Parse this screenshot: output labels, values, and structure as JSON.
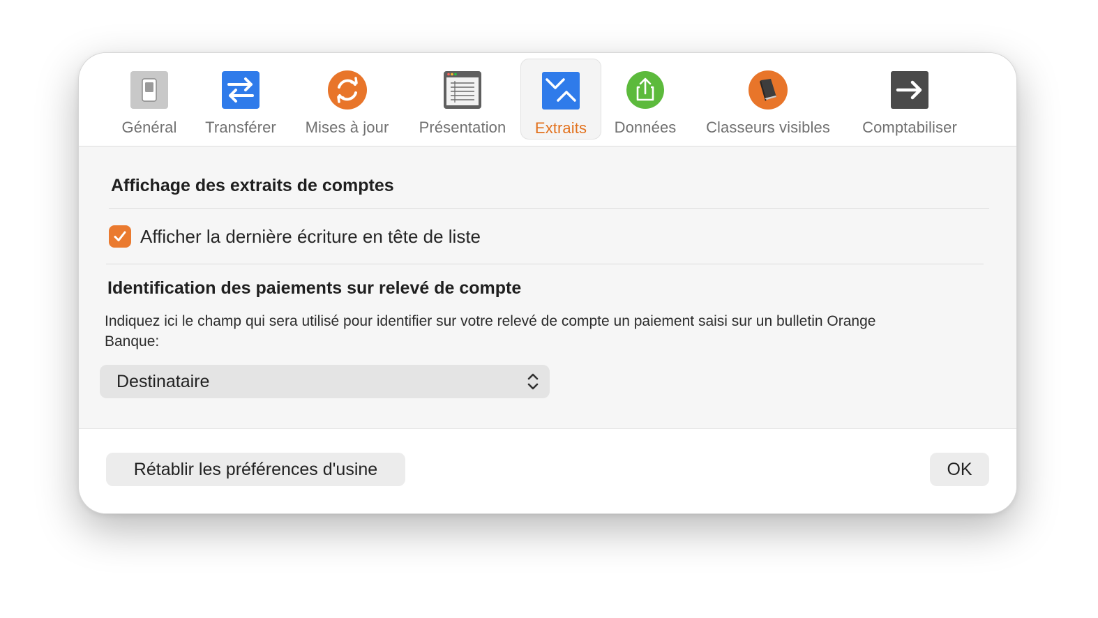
{
  "toolbar": {
    "tabs": [
      {
        "label": "Général",
        "icon": "switch-icon"
      },
      {
        "label": "Transférer",
        "icon": "transfer-arrows-icon"
      },
      {
        "label": "Mises à jour",
        "icon": "sync-icon"
      },
      {
        "label": "Présentation",
        "icon": "window-list-icon"
      },
      {
        "label": "Extraits",
        "icon": "statement-icon",
        "selected": true
      },
      {
        "label": "Données",
        "icon": "share-export-icon"
      },
      {
        "label": "Classeurs visibles",
        "icon": "binder-book-icon"
      },
      {
        "label": "Comptabiliser",
        "icon": "arrow-right-icon"
      }
    ]
  },
  "content": {
    "section1_title": "Affichage des extraits de comptes",
    "checkbox": {
      "label": "Afficher la dernière écriture en tête de liste",
      "checked": true
    },
    "section2_title": "Identification des paiements sur relevé de compte",
    "description": "Indiquez ici le champ qui sera utilisé pour identifier sur votre relevé de compte un paiement saisi sur un bulletin Orange Banque:",
    "popup": {
      "value": "Destinataire"
    }
  },
  "footer": {
    "reset_label": "Rétablir les préférences d'usine",
    "ok_label": "OK"
  },
  "colors": {
    "accent": "#e2711d",
    "checkbox": "#ea7a2f",
    "blue_icon": "#2f7bea",
    "green_icon": "#5cba3c",
    "dark_icon": "#4a4a4a"
  }
}
